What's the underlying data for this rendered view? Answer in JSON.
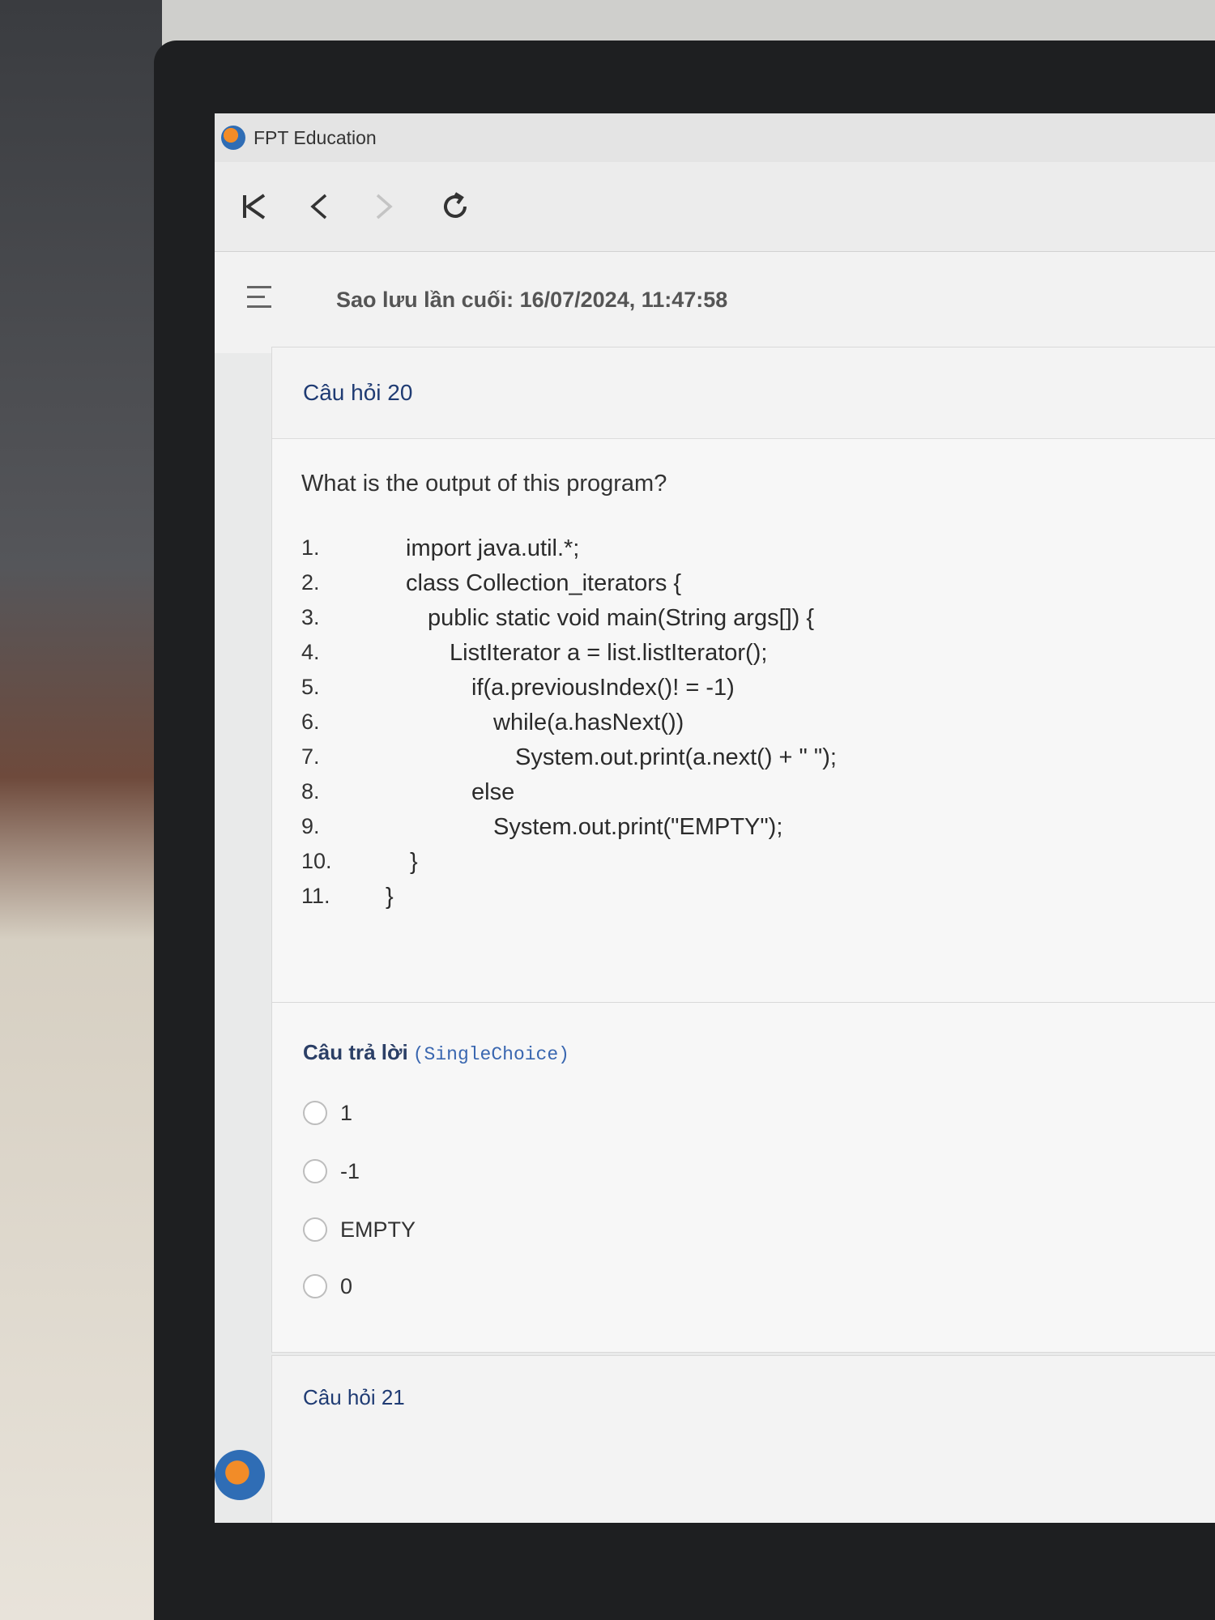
{
  "window": {
    "title": "FPT Education"
  },
  "toolbar": {
    "first_icon": "skip-to-start-icon",
    "back_icon": "chevron-left-icon",
    "forward_icon": "chevron-right-icon",
    "refresh_icon": "refresh-icon"
  },
  "header": {
    "last_saved": "Sao lưu lần cuối: 16/07/2024, 11:47:58"
  },
  "question": {
    "title": "Câu hỏi 20",
    "text": "What is the output of this program?",
    "code": [
      {
        "num": "1.",
        "text": "import java.util.*;"
      },
      {
        "num": "2.",
        "text": "class Collection_iterators {"
      },
      {
        "num": "3.",
        "text": "public static void main(String args[]) {"
      },
      {
        "num": "4.",
        "text": "ListIterator a = list.listIterator();"
      },
      {
        "num": "5.",
        "text": "if(a.previousIndex()! = -1)"
      },
      {
        "num": "6.",
        "text": "while(a.hasNext())"
      },
      {
        "num": "7.",
        "text": "System.out.print(a.next() + \" \");"
      },
      {
        "num": "8.",
        "text": "else"
      },
      {
        "num": "9.",
        "text": "System.out.print(\"EMPTY\");"
      },
      {
        "num": "10.",
        "text": "}"
      },
      {
        "num": "11.",
        "text": "}"
      }
    ],
    "answer_heading": "Câu trả lời",
    "answer_type": "(SingleChoice)",
    "options": [
      "1",
      "-1",
      "EMPTY",
      "0"
    ]
  },
  "next_question": {
    "title": "Câu hỏi 21"
  }
}
